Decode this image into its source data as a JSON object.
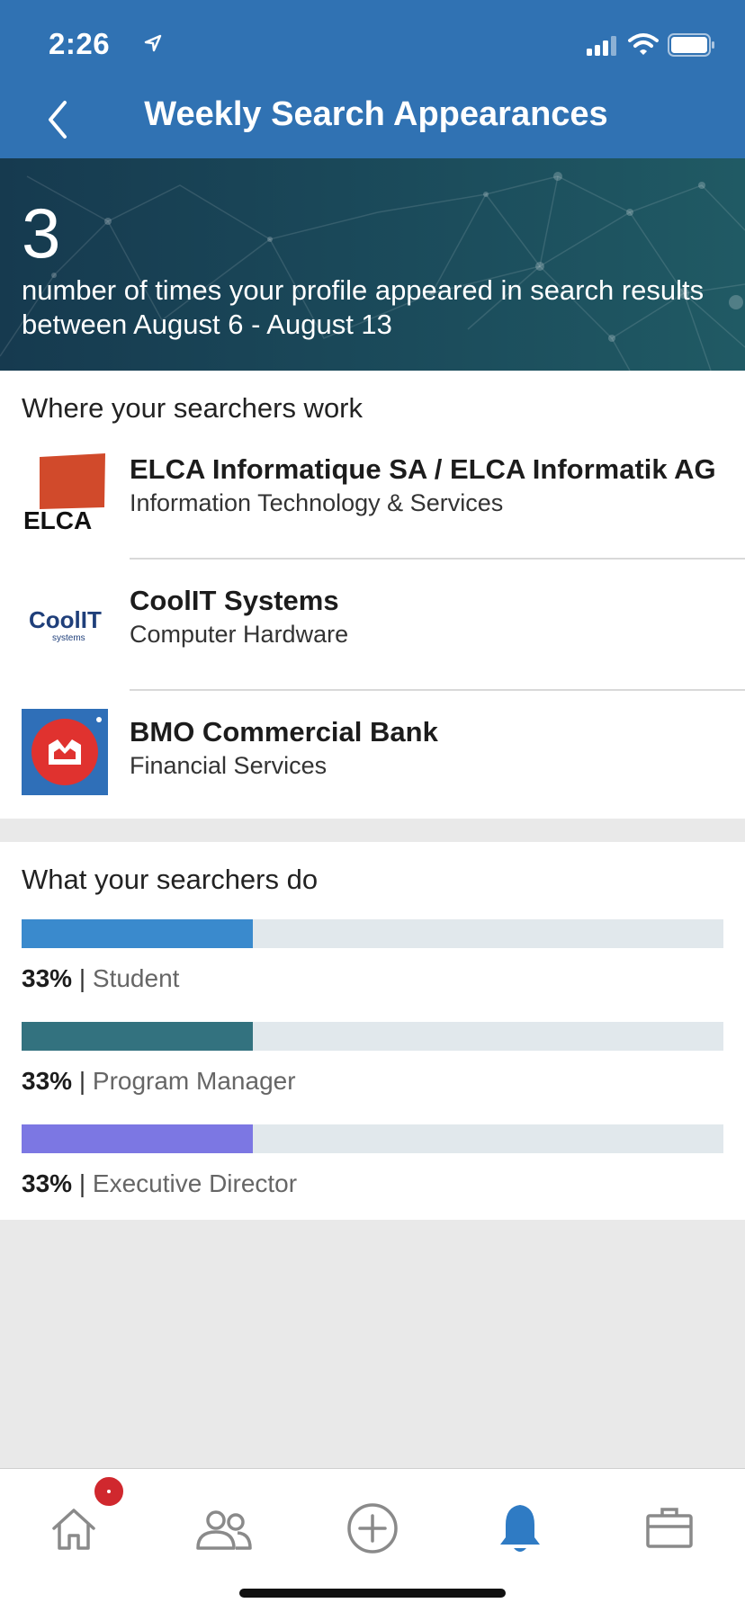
{
  "status_bar": {
    "time": "2:26"
  },
  "nav": {
    "title": "Weekly Search Appearances"
  },
  "hero": {
    "count": "3",
    "description": "number of times your profile appeared in search results between August 6 - August 13"
  },
  "work_section": {
    "title": "Where your searchers work",
    "companies": [
      {
        "name": "ELCA Informatique SA / ELCA Informatik AG",
        "industry": "Information Technology & Services",
        "logo_text": "ELCA",
        "logo_color": "#d14a2b"
      },
      {
        "name": "CoolIT Systems",
        "industry": "Computer Hardware",
        "logo_text": "CoolIT",
        "logo_subtext": "systems",
        "logo_color": "#1f3f7a"
      },
      {
        "name": "BMO Commercial Bank",
        "industry": "Financial Services",
        "logo_color": "#2f6fb8"
      }
    ]
  },
  "do_section": {
    "title": "What your searchers do",
    "roles": [
      {
        "percent_label": "33%",
        "separator": "|",
        "role": "Student",
        "fraction": 0.33,
        "color": "#3a8acd"
      },
      {
        "percent_label": "33%",
        "separator": "|",
        "role": "Program Manager",
        "fraction": 0.33,
        "color": "#33727f"
      },
      {
        "percent_label": "33%",
        "separator": "|",
        "role": "Executive Director",
        "fraction": 0.33,
        "color": "#7c77e3"
      }
    ]
  },
  "tabbar": {
    "tabs": [
      "home-icon",
      "network-icon",
      "post-icon",
      "notifications-icon",
      "jobs-icon"
    ],
    "active": "notifications-icon",
    "active_color": "#2f7bc4",
    "inactive_color": "#8a8a8a"
  }
}
